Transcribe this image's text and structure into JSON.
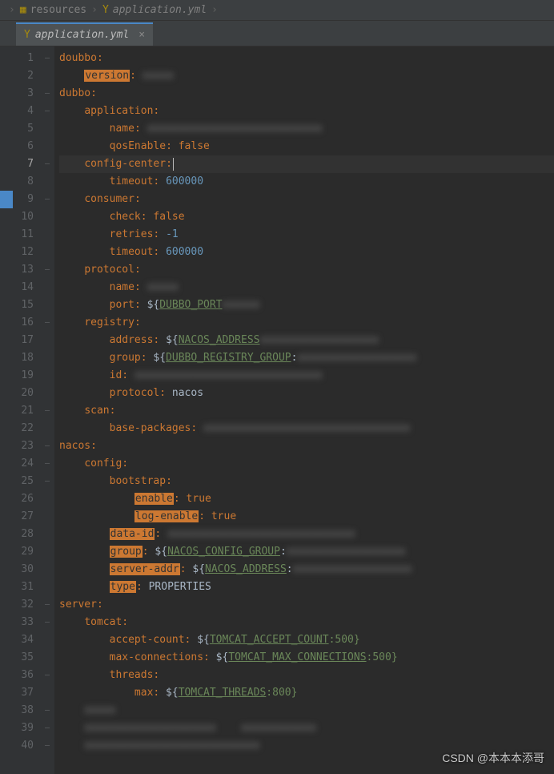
{
  "breadcrumb": {
    "folder": "resources",
    "file": "application.yml"
  },
  "tab": {
    "label": "application.yml"
  },
  "watermark": "CSDN @本本本添哥",
  "current_line": 7,
  "marker_line": 9,
  "lines": [
    {
      "n": 1,
      "indent": 0,
      "tokens": [
        {
          "t": "key",
          "v": "doubbo"
        },
        {
          "t": "colon",
          "v": ":"
        }
      ],
      "fold": "–"
    },
    {
      "n": 2,
      "indent": 2,
      "tokens": [
        {
          "t": "key-sel",
          "v": "version"
        },
        {
          "t": "colon",
          "v": ":"
        },
        {
          "t": "plain",
          "v": " "
        },
        {
          "t": "blur",
          "v": "xxxxx"
        }
      ],
      "fold": ""
    },
    {
      "n": 3,
      "indent": 0,
      "tokens": [
        {
          "t": "key",
          "v": "dubbo"
        },
        {
          "t": "colon",
          "v": ":"
        }
      ],
      "fold": "–"
    },
    {
      "n": 4,
      "indent": 2,
      "tokens": [
        {
          "t": "key",
          "v": "application"
        },
        {
          "t": "colon",
          "v": ":"
        }
      ],
      "fold": "–"
    },
    {
      "n": 5,
      "indent": 4,
      "tokens": [
        {
          "t": "key",
          "v": "name"
        },
        {
          "t": "colon",
          "v": ":"
        },
        {
          "t": "plain",
          "v": " "
        },
        {
          "t": "blur",
          "v": "xxxxxxxxxxxxxxxxxxxxxxxxxxxx"
        }
      ],
      "fold": ""
    },
    {
      "n": 6,
      "indent": 4,
      "tokens": [
        {
          "t": "key",
          "v": "qosEnable"
        },
        {
          "t": "colon",
          "v": ":"
        },
        {
          "t": "plain",
          "v": " "
        },
        {
          "t": "bool",
          "v": "false"
        }
      ],
      "fold": ""
    },
    {
      "n": 7,
      "indent": 2,
      "tokens": [
        {
          "t": "key",
          "v": "config-center"
        },
        {
          "t": "colon",
          "v": ":"
        },
        {
          "t": "cursor",
          "v": ""
        }
      ],
      "fold": "–",
      "hl": true
    },
    {
      "n": 8,
      "indent": 4,
      "tokens": [
        {
          "t": "key",
          "v": "timeout"
        },
        {
          "t": "colon",
          "v": ":"
        },
        {
          "t": "plain",
          "v": " "
        },
        {
          "t": "num",
          "v": "600000"
        }
      ],
      "fold": ""
    },
    {
      "n": 9,
      "indent": 2,
      "tokens": [
        {
          "t": "key",
          "v": "consumer"
        },
        {
          "t": "colon",
          "v": ":"
        }
      ],
      "fold": "–"
    },
    {
      "n": 10,
      "indent": 4,
      "tokens": [
        {
          "t": "key",
          "v": "check"
        },
        {
          "t": "colon",
          "v": ":"
        },
        {
          "t": "plain",
          "v": " "
        },
        {
          "t": "bool",
          "v": "false"
        }
      ],
      "fold": ""
    },
    {
      "n": 11,
      "indent": 4,
      "tokens": [
        {
          "t": "key",
          "v": "retries"
        },
        {
          "t": "colon",
          "v": ":"
        },
        {
          "t": "plain",
          "v": " "
        },
        {
          "t": "num",
          "v": "-1"
        }
      ],
      "fold": ""
    },
    {
      "n": 12,
      "indent": 4,
      "tokens": [
        {
          "t": "key",
          "v": "timeout"
        },
        {
          "t": "colon",
          "v": ":"
        },
        {
          "t": "plain",
          "v": " "
        },
        {
          "t": "num",
          "v": "600000"
        }
      ],
      "fold": ""
    },
    {
      "n": 13,
      "indent": 2,
      "tokens": [
        {
          "t": "key",
          "v": "protocol"
        },
        {
          "t": "colon",
          "v": ":"
        }
      ],
      "fold": "–"
    },
    {
      "n": 14,
      "indent": 4,
      "tokens": [
        {
          "t": "key",
          "v": "name"
        },
        {
          "t": "colon",
          "v": ":"
        },
        {
          "t": "plain",
          "v": " "
        },
        {
          "t": "blur",
          "v": "xxxxx"
        }
      ],
      "fold": ""
    },
    {
      "n": 15,
      "indent": 4,
      "tokens": [
        {
          "t": "key",
          "v": "port"
        },
        {
          "t": "colon",
          "v": ":"
        },
        {
          "t": "plain",
          "v": " ${"
        },
        {
          "t": "var",
          "v": "DUBBO_PORT"
        },
        {
          "t": "blur",
          "v": "xxxxxx"
        }
      ],
      "fold": ""
    },
    {
      "n": 16,
      "indent": 2,
      "tokens": [
        {
          "t": "key",
          "v": "registry"
        },
        {
          "t": "colon",
          "v": ":"
        }
      ],
      "fold": "–"
    },
    {
      "n": 17,
      "indent": 4,
      "tokens": [
        {
          "t": "key",
          "v": "address"
        },
        {
          "t": "colon",
          "v": ":"
        },
        {
          "t": "plain",
          "v": " ${"
        },
        {
          "t": "var",
          "v": "NACOS_ADDRESS"
        },
        {
          "t": "blur",
          "v": "xxxxxxxxxxxxxxxxxxx"
        }
      ],
      "fold": ""
    },
    {
      "n": 18,
      "indent": 4,
      "tokens": [
        {
          "t": "key",
          "v": "group"
        },
        {
          "t": "colon",
          "v": ":"
        },
        {
          "t": "plain",
          "v": " ${"
        },
        {
          "t": "var",
          "v": "DUBBO_REGISTRY_GROUP"
        },
        {
          "t": "plain",
          "v": ":"
        },
        {
          "t": "blur",
          "v": "xxxxxxxxxxxxxxxxxxx"
        }
      ],
      "fold": ""
    },
    {
      "n": 19,
      "indent": 4,
      "tokens": [
        {
          "t": "key",
          "v": "id"
        },
        {
          "t": "colon",
          "v": ":"
        },
        {
          "t": "plain",
          "v": " "
        },
        {
          "t": "blur",
          "v": "xxxxxxxxxxxxxxxxxxxxxxxxxxxxxx"
        }
      ],
      "fold": ""
    },
    {
      "n": 20,
      "indent": 4,
      "tokens": [
        {
          "t": "key",
          "v": "protocol"
        },
        {
          "t": "colon",
          "v": ":"
        },
        {
          "t": "plain",
          "v": " "
        },
        {
          "t": "str",
          "v": "nacos"
        }
      ],
      "fold": ""
    },
    {
      "n": 21,
      "indent": 2,
      "tokens": [
        {
          "t": "key",
          "v": "scan"
        },
        {
          "t": "colon",
          "v": ":"
        }
      ],
      "fold": "–"
    },
    {
      "n": 22,
      "indent": 4,
      "tokens": [
        {
          "t": "key",
          "v": "base-packages"
        },
        {
          "t": "colon",
          "v": ":"
        },
        {
          "t": "plain",
          "v": " "
        },
        {
          "t": "blur",
          "v": "xxxxxxxxxxxxxxxxxxxxxxxxxxxxxxxxx"
        }
      ],
      "fold": ""
    },
    {
      "n": 23,
      "indent": 0,
      "tokens": [
        {
          "t": "key",
          "v": "nacos"
        },
        {
          "t": "colon",
          "v": ":"
        }
      ],
      "fold": "–"
    },
    {
      "n": 24,
      "indent": 2,
      "tokens": [
        {
          "t": "key",
          "v": "config"
        },
        {
          "t": "colon",
          "v": ":"
        }
      ],
      "fold": "–"
    },
    {
      "n": 25,
      "indent": 4,
      "tokens": [
        {
          "t": "key",
          "v": "bootstrap"
        },
        {
          "t": "colon",
          "v": ":"
        }
      ],
      "fold": "–"
    },
    {
      "n": 26,
      "indent": 6,
      "tokens": [
        {
          "t": "key-sel",
          "v": "enable"
        },
        {
          "t": "colon",
          "v": ":"
        },
        {
          "t": "plain",
          "v": " "
        },
        {
          "t": "bool",
          "v": "true"
        }
      ],
      "fold": ""
    },
    {
      "n": 27,
      "indent": 6,
      "tokens": [
        {
          "t": "key-sel",
          "v": "log-enable"
        },
        {
          "t": "colon",
          "v": ":"
        },
        {
          "t": "plain",
          "v": " "
        },
        {
          "t": "bool",
          "v": "true"
        }
      ],
      "fold": ""
    },
    {
      "n": 28,
      "indent": 4,
      "tokens": [
        {
          "t": "key-sel",
          "v": "data-id"
        },
        {
          "t": "colon",
          "v": ":"
        },
        {
          "t": "plain",
          "v": " "
        },
        {
          "t": "blur",
          "v": "xxxxxxxxxxxxxxxxxxxxxxxxxxxxxx"
        }
      ],
      "fold": ""
    },
    {
      "n": 29,
      "indent": 4,
      "tokens": [
        {
          "t": "key-sel",
          "v": "group"
        },
        {
          "t": "colon",
          "v": ":"
        },
        {
          "t": "plain",
          "v": " ${"
        },
        {
          "t": "var",
          "v": "NACOS_CONFIG_GROUP"
        },
        {
          "t": "plain",
          "v": ":"
        },
        {
          "t": "blur",
          "v": "xxxxxxxxxxxxxxxxxxx"
        }
      ],
      "fold": ""
    },
    {
      "n": 30,
      "indent": 4,
      "tokens": [
        {
          "t": "key-sel",
          "v": "server-addr"
        },
        {
          "t": "colon",
          "v": ":"
        },
        {
          "t": "plain",
          "v": " ${"
        },
        {
          "t": "var",
          "v": "NACOS_ADDRESS"
        },
        {
          "t": "plain",
          "v": ":"
        },
        {
          "t": "blur",
          "v": "xxxxxxxxxxxxxxxxxxx"
        }
      ],
      "fold": ""
    },
    {
      "n": 31,
      "indent": 4,
      "tokens": [
        {
          "t": "key-sel",
          "v": "type"
        },
        {
          "t": "colon",
          "v": ":"
        },
        {
          "t": "plain",
          "v": " "
        },
        {
          "t": "str",
          "v": "PROPERTIES"
        }
      ],
      "fold": ""
    },
    {
      "n": 32,
      "indent": 0,
      "tokens": [
        {
          "t": "key",
          "v": "server"
        },
        {
          "t": "colon",
          "v": ":"
        }
      ],
      "fold": "–"
    },
    {
      "n": 33,
      "indent": 2,
      "tokens": [
        {
          "t": "key",
          "v": "tomcat"
        },
        {
          "t": "colon",
          "v": ":"
        }
      ],
      "fold": "–"
    },
    {
      "n": 34,
      "indent": 4,
      "tokens": [
        {
          "t": "key",
          "v": "accept-count"
        },
        {
          "t": "colon",
          "v": ":"
        },
        {
          "t": "plain",
          "v": " ${"
        },
        {
          "t": "var",
          "v": "TOMCAT_ACCEPT_COUNT"
        },
        {
          "t": "default",
          "v": ":500}"
        }
      ],
      "fold": ""
    },
    {
      "n": 35,
      "indent": 4,
      "tokens": [
        {
          "t": "key",
          "v": "max-connections"
        },
        {
          "t": "colon",
          "v": ":"
        },
        {
          "t": "plain",
          "v": " ${"
        },
        {
          "t": "var",
          "v": "TOMCAT_MAX_CONNECTIONS"
        },
        {
          "t": "default",
          "v": ":500}"
        }
      ],
      "fold": ""
    },
    {
      "n": 36,
      "indent": 4,
      "tokens": [
        {
          "t": "key",
          "v": "threads"
        },
        {
          "t": "colon",
          "v": ":"
        }
      ],
      "fold": "–"
    },
    {
      "n": 37,
      "indent": 6,
      "tokens": [
        {
          "t": "key",
          "v": "max"
        },
        {
          "t": "colon",
          "v": ":"
        },
        {
          "t": "plain",
          "v": " ${"
        },
        {
          "t": "var",
          "v": "TOMCAT_THREADS"
        },
        {
          "t": "default",
          "v": ":800}"
        }
      ],
      "fold": ""
    },
    {
      "n": 38,
      "indent": 2,
      "tokens": [
        {
          "t": "blur",
          "v": "xxxxx"
        }
      ],
      "fold": "–"
    },
    {
      "n": 39,
      "indent": 2,
      "tokens": [
        {
          "t": "blur",
          "v": "xxxxxxxxxxxxxxxxxxxxx    xxxxxxxxxxxx"
        }
      ],
      "fold": "–"
    },
    {
      "n": 40,
      "indent": 2,
      "tokens": [
        {
          "t": "blur",
          "v": "xxxxxxxxxxxxxxxxxxxxxxxxxxxx"
        }
      ],
      "fold": "–"
    }
  ]
}
